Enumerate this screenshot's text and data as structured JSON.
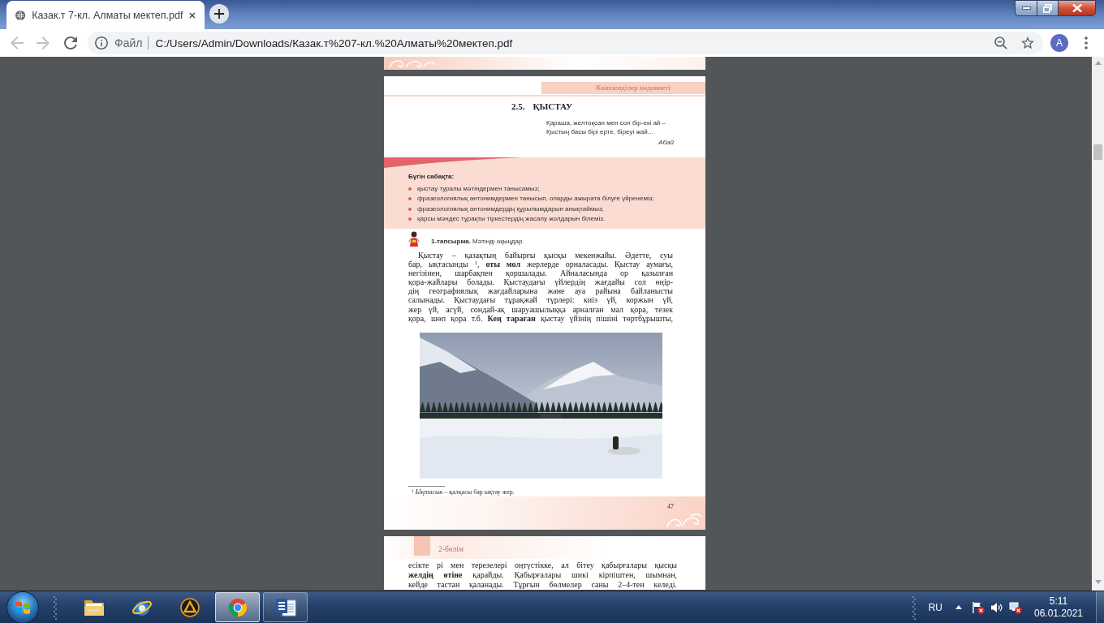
{
  "browser": {
    "tabs": [
      {
        "title": "Казак.т 7-кл. Алматы мектеп.pdf",
        "selected": true
      }
    ],
    "navigation": {
      "back": {
        "disabled": true
      },
      "forward": {
        "disabled": true
      }
    },
    "address_bar": {
      "scheme": "Файл",
      "url": "C:/Users/Admin/Downloads/Казак.т%207-кл.%20Алматы%20мектеп.pdf"
    },
    "profile": "A"
  },
  "pdf": {
    "page": {
      "running_header": "Көшпенділер мәдениеті",
      "section_number": "2.5.",
      "section_title": "ҚЫСТАУ",
      "epigraph": {
        "lines": [
          "Қараша, желтоқсан мен сол бір-екі ай –",
          "Қыстың басы бірі ерте, біреуі жай..."
        ],
        "author": "Абай"
      },
      "lesson_goals": {
        "heading": "Бүгін сабақта:",
        "items": [
          "қыстау туралы мәтіндермен танысамыз;",
          "фразеологиялық антонимдермен танысып, оларды ажырата білуге үйренеміз;",
          "фразеологиялық антонимдердің құрылымдарын анықтаймыз;",
          "қарсы мәндес тұрақты тіркестердің жасалу жолдарын білеміз."
        ]
      },
      "task": "**1-тапсырма.** Мәтінді оқыңдар.",
      "paragraph": [
        "Қыстау – қазақтың байырғы қысқы мекенжайы. Әдетте, суы",
        "бар, ықтасынды $^{1}$, **оты мол** жерлерде орналасады. Қыстау аумағы,",
        "негізінен, шарбақпен қоршалады. Айналасында ор қазылған",
        "қора-жайлары болады. Қыстаудағы үйлердің жағдайы сол өңір-",
        "дің географиялық жағдайларына және ауа райына байланысты",
        "салынады. Қыстаудағы тұрақжай түрлері: киіз үй, коржын үй,",
        "жер үй, асүй, сондай-ақ шаруашылыққа арналған мал қора, тезек",
        "қора, шөп қора т.б. **Кең тараған** қыстау үйінің пішіні төртбұрышты,"
      ],
      "footnote": "$^{1}$ *Ықтасын* – қалқасы бар ықтау жер.",
      "page_number": "47"
    },
    "next_page": {
      "running_header": "2-бөлім",
      "paragraph": [
        "есікте рі мен терезелері оңтүстікке, ал бітеу қабырғалары қысқы",
        "**желдің өтіне** қарайды. Қабырғалары шикі кірпіштен, шымнан,",
        "кейде тастан қаланады. Тұрғын бөлмелер саны 2–4-тен келеді."
      ]
    }
  },
  "taskbar": {
    "apps": [
      {
        "open": false,
        "selected": false
      },
      {
        "open": false,
        "selected": false
      },
      {
        "open": false,
        "selected": false
      },
      {
        "open": true,
        "selected": true
      },
      {
        "open": true,
        "selected": false
      }
    ],
    "language": "RU",
    "time": "5:11",
    "date": "06.01.2021"
  }
}
